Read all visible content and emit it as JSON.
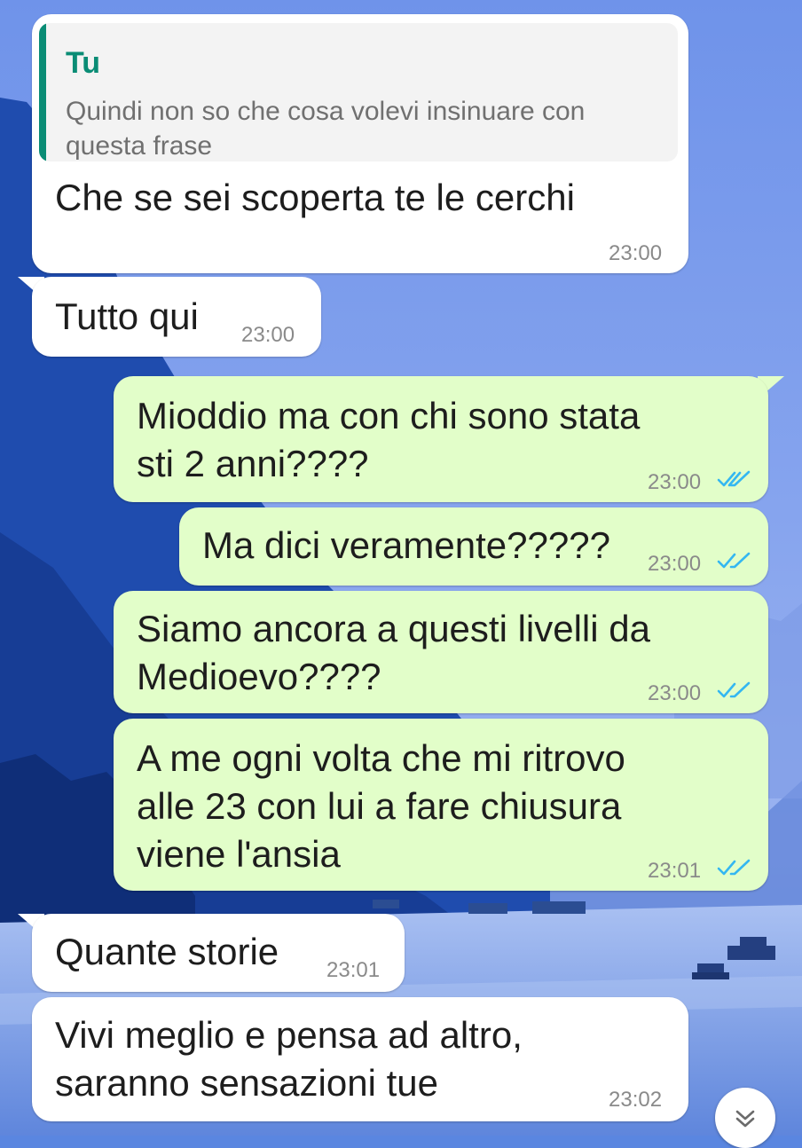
{
  "messages": [
    {
      "direction": "incoming",
      "reply": {
        "author": "Tu",
        "text": "Quindi non so che cosa volevi insinuare con questa frase",
        "line1": "Quindi non so che cosa volevi insinuare con",
        "line2": "questa frase"
      },
      "lines": [
        "Che se sei scoperta te le cerchi"
      ],
      "time": "23:00"
    },
    {
      "direction": "incoming",
      "lines": [
        "Tutto qui"
      ],
      "time": "23:00"
    },
    {
      "direction": "outgoing",
      "lines": [
        "Mioddio ma con chi sono stata",
        "sti 2 anni????"
      ],
      "time": "23:00",
      "status": "read"
    },
    {
      "direction": "outgoing",
      "lines": [
        "Ma dici veramente?????"
      ],
      "time": "23:00",
      "status": "read"
    },
    {
      "direction": "outgoing",
      "lines": [
        "Siamo ancora a questi livelli da",
        "Medioevo????"
      ],
      "time": "23:00",
      "status": "read"
    },
    {
      "direction": "outgoing",
      "lines": [
        "A me ogni volta che mi ritrovo",
        "alle 23 con lui a fare chiusura",
        "viene l'ansia"
      ],
      "time": "23:01",
      "status": "read"
    },
    {
      "direction": "incoming",
      "lines": [
        "Quante storie"
      ],
      "time": "23:01"
    },
    {
      "direction": "incoming",
      "lines": [
        "Vivi meglio e pensa ad altro,",
        "saranno sensazioni tue"
      ],
      "time": "23:02"
    }
  ],
  "scroll_button": {
    "icon": "double-chevron-down-icon"
  },
  "read_receipt": {
    "icon": "double-check-icon",
    "color": "#34b7f1"
  },
  "colors": {
    "incoming_bubble": "#ffffff",
    "outgoing_bubble": "#e2fec9",
    "reply_accent": "#0a8c75",
    "timestamp": "#8a8a8a",
    "text": "#1d1d1d",
    "wallpaper_sky": "#5a86e0",
    "wallpaper_mountains": "#1d4aa6"
  },
  "wallpaper": {
    "description": "blue sky, mountains and river with boats"
  }
}
